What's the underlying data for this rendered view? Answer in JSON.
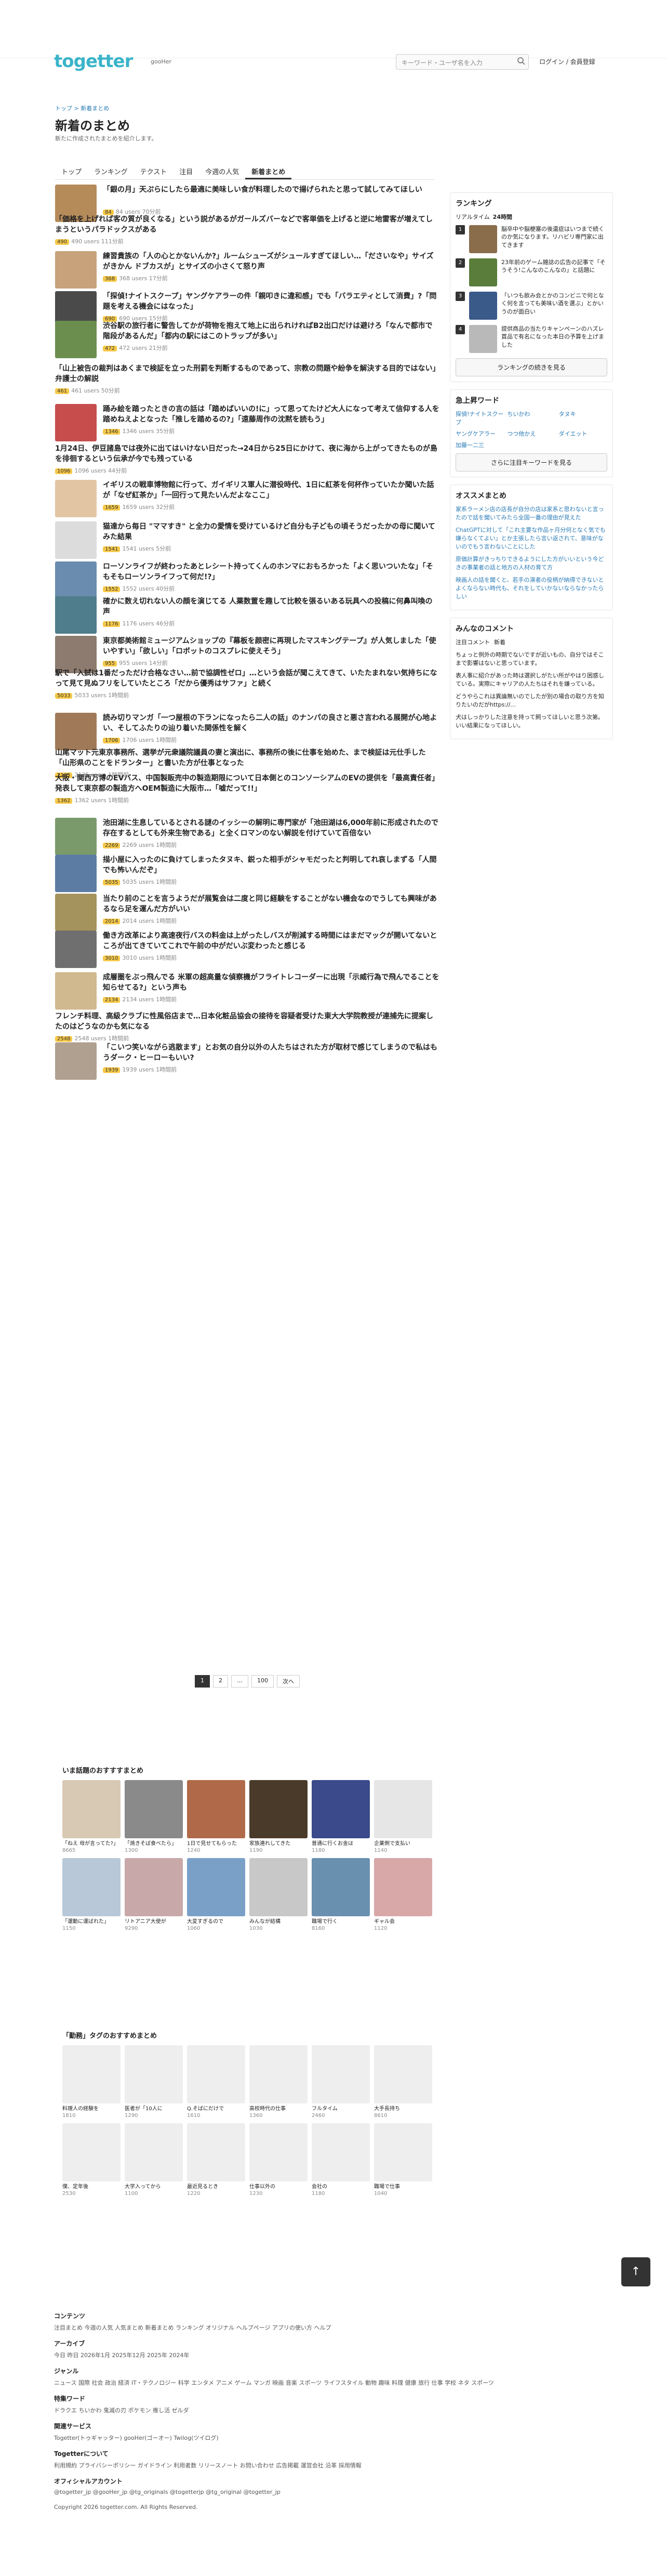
{
  "header": {
    "logo": "togetter",
    "logo_sub": "gooHer",
    "search_placeholder": "キーワード・ユーザ名を入力",
    "login": "ログイン / 会員登録"
  },
  "breadcrumb": "トップ > 新着まとめ",
  "page_title": "新着のまとめ",
  "page_desc": "新たに作成されたまとめを紹介します。",
  "tabs": [
    "トップ",
    "ランキング",
    "テクスト",
    "注目",
    "今週の人気",
    "新着まとめ"
  ],
  "articles": [
    {
      "title": "「銀の月」天ぷらにしたら最適に美味しい食が料理したので揚げられたと思って試してみてほしい",
      "meta": "84 users 70分前",
      "badge": "84"
    },
    {
      "title": "「価格を上げれば客の質が良くなる」という説があるがガールズバーなどで客単価を上げると逆に地雷客が増えてしまうというパラドックスがある",
      "meta": "490 users 111分前",
      "badge": "490"
    },
    {
      "title": "練習貴族の「人の心とかないんか?」ルームシューズがシュールすぎてほしい…「ださいなや」サイズがきかん ドブカスが」とサイズの小さくて怒り声",
      "meta": "368 users 17分前",
      "badge": "368"
    },
    {
      "title": "「探偵!ナイトスクープ」ヤングケアラーの件「親叩きに違和感」でも「バラエティとして消費」?「問題を考える機会にはなった」",
      "meta": "690 users 15分前",
      "badge": "690"
    },
    {
      "title": "渋谷駅の旅行者に警告してかが荷物を抱えて地上に出られければB2出口だけは避けろ「なんで都市で階段があるんだ」「都内の駅にはこのトラップが多い」",
      "meta": "472 users 21分前",
      "badge": "472"
    },
    {
      "title": "「山上被告の裁判はあくまで検証を立った刑罰を判断するものであって、宗教の問題や紛争を解決する目的ではない」弁護士の解説",
      "meta": "461 users 50分前",
      "badge": "461"
    },
    {
      "title": "踊み絵を踏ったときの言の話は「踏めばいいの!に」って思ってたけど大人になって考えて信仰する人を踏めねえよとなった「推しを踏めるの?」「遠藤周作の沈黙を読もう」",
      "meta": "1346 users 35分前",
      "badge": "1346"
    },
    {
      "title": "1月24日、伊豆諸島では夜外に出てはいけない日だった→24日から25日にかけて、夜に海から上がってきたものが島を徘徊するという伝承が今でも残っている",
      "meta": "1096 users 44分前",
      "badge": "1096"
    },
    {
      "title": "イギリスの戦車博物館に行って、ガイギリス軍人に潜役時代、1日に紅茶を何杯作っていたか聞いた話が「なぜ紅茶か」「一回行って見たいんだよなここ」",
      "meta": "1659 users 32分前",
      "badge": "1659"
    },
    {
      "title": "猫達から毎日 \"ママすき\" と全力の愛情を受けているけど自分も子どもの頃そうだったかの母に聞いてみた結果",
      "meta": "1541 users 5分前",
      "badge": "1541"
    },
    {
      "title": "ローソンライフが終わったあとレシート持ってくんのホンマにおもろかった「よく思いついたな」「そもそもローソンライフって何だ!?」",
      "meta": "1552 users 40分前",
      "badge": "1552"
    },
    {
      "title": "確かに数え切れない人の顔を演じてる 人薬数置を趣して比較を張るいある玩具への投稿に何鼻叫喚の声",
      "meta": "1176 users 46分前",
      "badge": "1176"
    },
    {
      "title": "東京都美術館ミュージアムショップの『幕板を颜密に再現したマスキングテープ』が人気しました「使いやすい」「欲しい」「ロボットのコスプレに使えそう」",
      "meta": "955 users 14分前",
      "badge": "955"
    },
    {
      "title": "駅で「入試は1番だっただけ合格なさい…前で協調性ゼロ」…という会話が聞こえてきて、いたたまれない気持ちになって見て見ぬフリをしていたところ「だから優秀はサファ」と続く",
      "meta": "5033 users 1時間前",
      "badge": "5033"
    },
    {
      "title": "読み切りマンガ「一つ屋根の下ランになったら二人の話」のナンパの良さと悪さ言われる展開が心地よい、そしてふたりの辿り着いた関係性を解く",
      "meta": "1706 users 1時間前",
      "badge": "1706"
    },
    {
      "title": "山尾マット元東京事務所、選挙が元衆議院議員の妻と演出に、事務所の後に仕事を始めた、まで検証は元仕手した「山形県のことをドランター」と書いた方が仕事となった",
      "meta": "2135 users 1時間前",
      "badge": "2135"
    },
    {
      "title": "大阪・関西万博のEVバス、中国製販売中の製造期限について日本側とのコンソーシアムのEVの提供を「最高責任者」発表して東京都の製造方へOEM製造に大阪市…「嘘だって!!」",
      "meta": "1362 users 1時間前",
      "badge": "1362"
    },
    {
      "title": "池田湖に生息しているとされる謎のイッシーの解明に専門家が「池田湖は6,000年前に形成されたので存在するとしても外来生物である」と全くロマンのない解説を付けていて百倍ない",
      "meta": "2269 users 1時間前",
      "badge": "2269"
    },
    {
      "title": "描小屋に入ったのに負けてしまったタヌキ、鋭った相手がシャモだったと判明してれ哀しまずる「人間でも怖いんだぞ」",
      "meta": "5035 users 1時間前",
      "badge": "5035"
    },
    {
      "title": "当たり前のことを言うようだが展覧会は二度と同じ経験をすることがない機会なのでうしても興味があるなら足を運んだ方がいい",
      "meta": "2014 users 1時間前",
      "badge": "2014"
    },
    {
      "title": "働き方改革により高速夜行バスの料金は上がったしバスが削減する時間にはまだマックが開いてないところが出てきていてこれで午前の中がだいぶ変わったと感じる",
      "meta": "3010 users 1時間前",
      "badge": "3010"
    },
    {
      "title": "成層圏をぶっ飛んでる 米軍の超高量な偵察機がフライトレコーダーに出現「示威行為で飛んでることを知らせてる?」という声も",
      "meta": "2134 users 1時間前",
      "badge": "2134"
    },
    {
      "title": "フレンチ料理、高級クラブに性風俗店まで…日本化粧品協会の接待を容疑者受けた東大大学院教授が連捕先に提案したのはどうなのかも気になる",
      "meta": "2548 users 1時間前",
      "badge": "2548"
    },
    {
      "title": "「こいつ笑いながら逃散ます」とお気の自分以外の人たちはされた方が取材で感じてしまうので私はもうダーク・ヒーローもいい?",
      "meta": "1939 users 1時間前",
      "badge": "1939"
    }
  ],
  "pager": [
    "1",
    "2",
    "…",
    "100",
    "次へ"
  ],
  "sidebar": {
    "ranking_title": "ランキング",
    "ranking_tabs": [
      "リアルタイム",
      "24時間"
    ],
    "ranking": [
      {
        "n": "1",
        "text": "脳卒中や脳梗塞の後遺症はいつまで続くのか気になります。リハビリ専門家に出てきます"
      },
      {
        "n": "2",
        "text": "23年前のゲーム雑誌の広告の記事で「そうそう!こんなのこんなの」と話題に"
      },
      {
        "n": "3",
        "text": "「いつも飲み会とかのコンビニで何となく何を言っても美味い酒を選ぶ」とかいうのが面白い"
      },
      {
        "n": "4",
        "text": "提供商品の当たりキャンペーンのハズレ賞品で有名になった本日の予算を上げました"
      }
    ],
    "ranking_more": "ランキングの続きを見る",
    "keywords_title": "急上昇ワード",
    "keywords": [
      "探偵!ナイトスクープ",
      "ちいかわ",
      "タヌキ",
      "ヤングケアラー",
      "つつ他かえ",
      "ダイエット",
      "加藤一二三",
      "テ",
      "〇"
    ],
    "keywords_more": "さらに注目キーワードを見る",
    "recommend_title": "オススメまとめ",
    "recommend": [
      "家系ラーメン店の店長が自分の店は家系と思わないと言ったので話を聞いてみたら全国一番の理由が見えた",
      "ChatGPTに対して「これ主要な作品ヶ月分何となく気でも嫌らなくてよい」とか主張したら言い返されて、意味がないのでもう言わないことにした",
      "原価計算がきっちりできるようにした方がいいという今どきの事業者の話と地方の人材の育て方",
      "映画人の話を聞くと、若手の演者の役柄が納得できないとよくならない時代も、それをしていかないならなかったらしい"
    ],
    "comments_title": "みんなのコメント",
    "comments_tabs": [
      "注目コメント",
      "新着"
    ],
    "comments": [
      "ちょっと例外の時期でないですが近いもの、自分ではそこまで影響はないと思っています。",
      "表人事に紹介があった時は選択しがたい所がやはり困惑している。実際にキャリアの人たちはそれを嫌っている。",
      "どうやらこれは異論無いのでしたが別の場合の取り方を知りたいのだがhttps://...",
      "犬はしっかりした注意を持って飼ってほしいと思う次第。いい結果になってほしい。"
    ]
  },
  "sections": [
    {
      "title": "いま話題のおすすすまとめ",
      "cards": [
        {
          "t": "「ねえ 母が言ってた?」",
          "c": "8665"
        },
        {
          "t": "「焼きそば食べたら」",
          "c": "1300"
        },
        {
          "t": "1日で見せてもらった",
          "c": "1240"
        },
        {
          "t": "家族連れしてきた",
          "c": "1190"
        },
        {
          "t": "普通に行くお金は",
          "c": "1180"
        },
        {
          "t": "企業側で支払い",
          "c": "1140"
        },
        {
          "t": "「運動に運ばれた」",
          "c": "1150"
        },
        {
          "t": "リトアニア大使が",
          "c": "9290"
        },
        {
          "t": "大変すぎるので",
          "c": "1060"
        },
        {
          "t": "みんなが結構",
          "c": "1030"
        },
        {
          "t": "職場で行く",
          "c": "8160"
        },
        {
          "t": "ギャル会",
          "c": "1120"
        }
      ]
    },
    {
      "title": "「勤務」タグのおすすめまとめ",
      "cards": [
        {
          "t": "料理人の経験を",
          "c": "1810"
        },
        {
          "t": "医者が「10人に",
          "c": "1290"
        },
        {
          "t": "Q.そばにだけで",
          "c": "1610"
        },
        {
          "t": "高校時代の仕事",
          "c": "1360"
        },
        {
          "t": "フルタイム",
          "c": "2460"
        },
        {
          "t": "大手長持ち",
          "c": "8610"
        },
        {
          "t": "僕、定年後",
          "c": "2530"
        },
        {
          "t": "大学入ってから",
          "c": "1100"
        },
        {
          "t": "最近見るとき",
          "c": "1220"
        },
        {
          "t": "仕事以外の",
          "c": "1230"
        },
        {
          "t": "会社の",
          "c": "1180"
        },
        {
          "t": "職場で仕事",
          "c": "1040"
        }
      ]
    }
  ],
  "footer": {
    "contents_title": "コンテンツ",
    "contents": "注目まとめ 今週の人気 人気まとめ 新着まとめ ランキング オリジナル ヘルプページ アプリの使い方 ヘルプ",
    "archive_title": "アーカイブ",
    "archive": "今日 昨日 2026年1月 2025年12月 2025年 2024年",
    "genre_title": "ジャンル",
    "genre": "ニュース 国際 社会 政治 経済 IT・テクノロジー 科学 エンタメ アニメ ゲーム マンガ 映画 音楽 スポーツ ライフスタイル 動物 趣味 料理 健康 旅行 仕事 学校 ネタ スポーツ",
    "special_title": "特集ワード",
    "special": "ドラクエ ちいかわ 鬼滅の刃 ポケモン 推し活 ゼルダ",
    "related_title": "関連サービス",
    "related": "Togetter(トゥギャッター) gooHer(ゴーオー) Twilog(ツイログ)",
    "togetter_title": "Togetterについて",
    "togetter": "利用規約 プライバシーポリシー ガイドライン 利用者数 リリースノート お問い合わせ 広告掲載 運営会社 沿革 採用情報",
    "official_title": "オフィシャルアカウント",
    "official": "@togetter_jp @gooHer_jp @tg_originals @togetterjp @tg_original @togetter_jp",
    "copyright": "Copyright 2026 togetter.com. All Rights Reserved."
  },
  "float_button": "↑"
}
